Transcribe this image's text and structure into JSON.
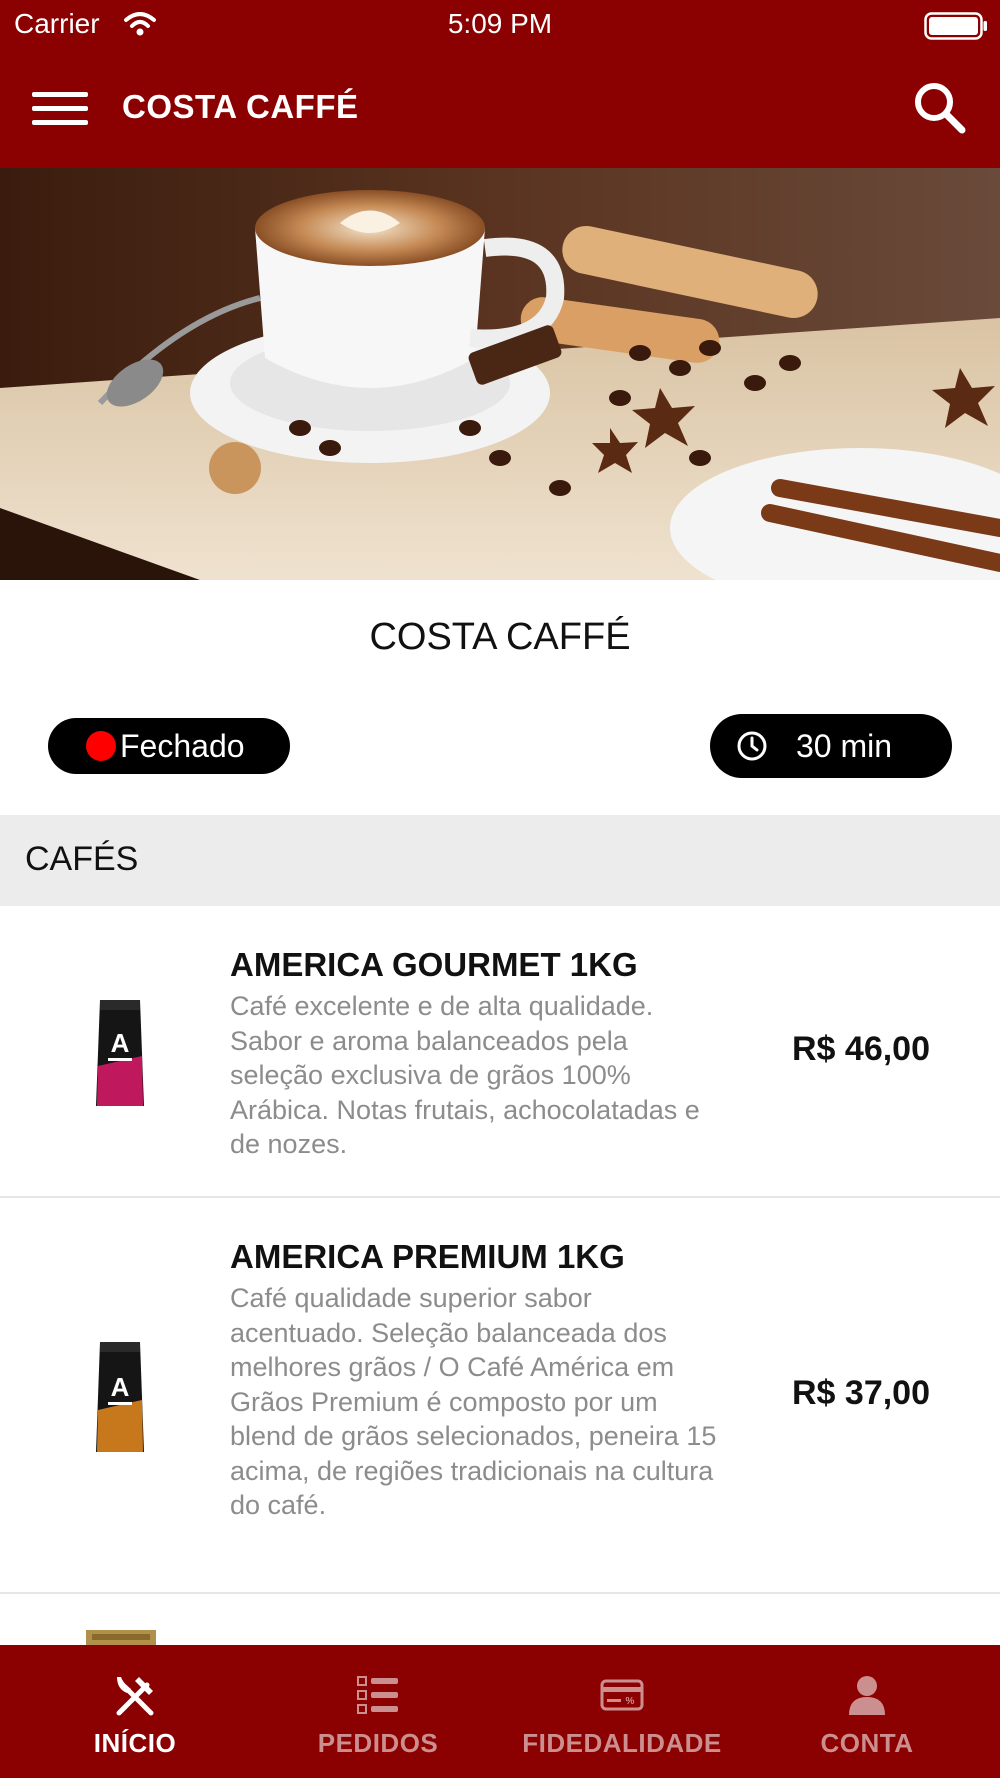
{
  "status_bar": {
    "carrier": "Carrier",
    "time": "5:09 PM"
  },
  "nav": {
    "title": "COSTA CAFFÉ",
    "menu_icon": "hamburger-menu-icon",
    "search_icon": "search-icon"
  },
  "store": {
    "name": "COSTA CAFFÉ",
    "status": "Fechado",
    "status_color": "#ff0000",
    "delivery_time": "30 min"
  },
  "section": {
    "title": "CAFÉS"
  },
  "products": [
    {
      "name": "AMERICA GOURMET 1KG",
      "description": "Café excelente e de alta qualidade. Sabor e aroma balanceados pela seleção exclusiva de grãos 100% Arábica. Notas frutais, achocolatadas e de nozes.",
      "price": "R$ 46,00",
      "package_color": "#c0185c"
    },
    {
      "name": "AMERICA PREMIUM 1KG",
      "description": "Café qualidade superior sabor acentuado. Seleção balanceada dos melhores grãos / O Café América em Grãos Premium é composto por um blend de grãos selecionados, peneira 15 acima, de regiões tradicionais na cultura do café.",
      "price": "R$ 37,00",
      "package_color": "#c8781c"
    }
  ],
  "tabs": [
    {
      "label": "INÍCIO",
      "icon": "fork-knife-icon",
      "active": true
    },
    {
      "label": "PEDIDOS",
      "icon": "checklist-icon",
      "active": false
    },
    {
      "label": "FIDEDALIDADE",
      "icon": "credit-card-icon",
      "active": false
    },
    {
      "label": "CONTA",
      "icon": "person-icon",
      "active": false
    }
  ],
  "colors": {
    "brand": "#8b0000",
    "inactive_tab": "#cc8f8f"
  }
}
